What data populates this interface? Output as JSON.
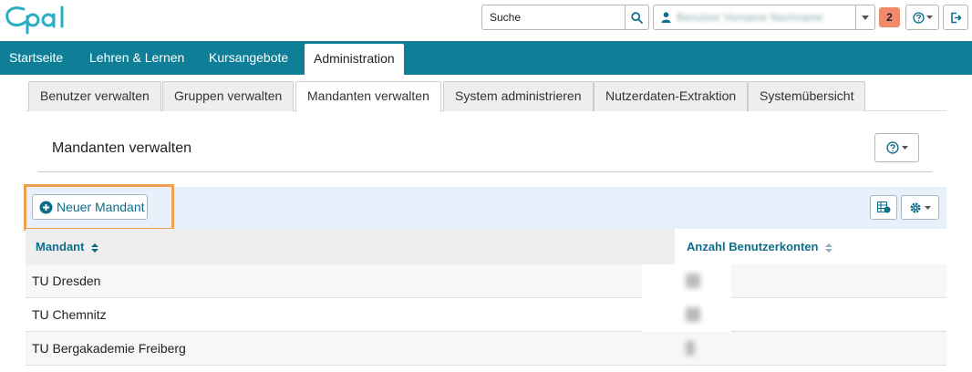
{
  "header": {
    "logo_text": "opal",
    "search_placeholder": "Suche",
    "user_name": "Benutzer Vorname Nachname",
    "notification_count": "2"
  },
  "nav": {
    "items": [
      {
        "label": "Startseite"
      },
      {
        "label": "Lehren & Lernen"
      },
      {
        "label": "Kursangebote"
      },
      {
        "label": "Administration"
      }
    ]
  },
  "subtabs": {
    "items": [
      {
        "label": "Benutzer verwalten"
      },
      {
        "label": "Gruppen verwalten"
      },
      {
        "label": "Mandanten verwalten"
      },
      {
        "label": "System administrieren"
      },
      {
        "label": "Nutzerdaten-Extraktion"
      },
      {
        "label": "Systemübersicht"
      }
    ]
  },
  "page": {
    "title": "Mandanten verwalten"
  },
  "toolbar": {
    "new_label": "Neuer Mandant"
  },
  "table": {
    "columns": [
      "Mandant",
      "Anzahl Benutzerkonten"
    ],
    "rows": [
      {
        "name": "TU Dresden"
      },
      {
        "name": "TU Chemnitz"
      },
      {
        "name": "TU Bergakademie Freiberg"
      }
    ]
  },
  "colors": {
    "nav_bg": "#0e7f96",
    "accent": "#0e6e8a",
    "notification": "#f08a6c",
    "highlight": "#f0a050"
  }
}
